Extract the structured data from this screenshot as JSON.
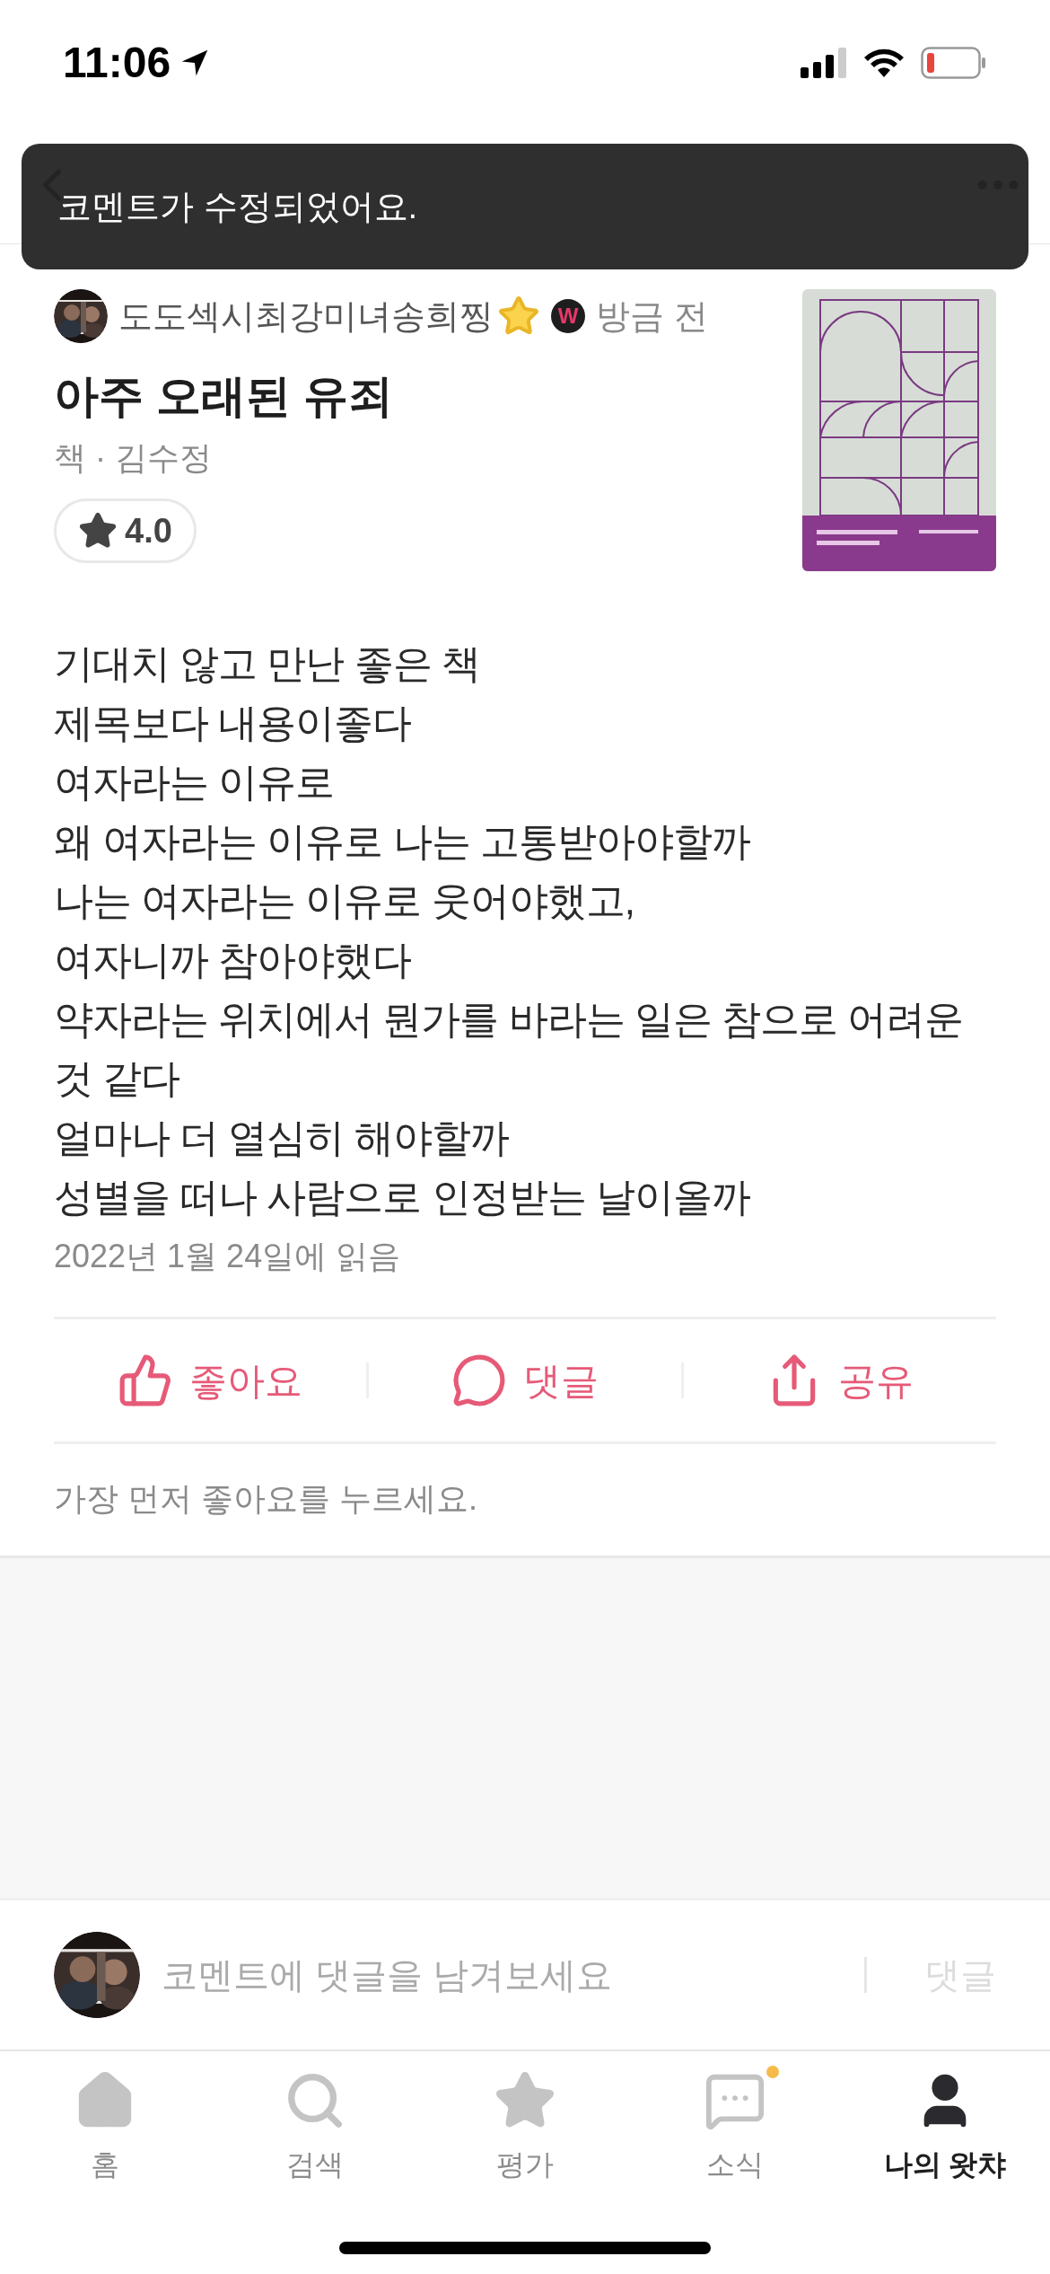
{
  "status_bar": {
    "time": "11:06"
  },
  "toast": {
    "message": "코멘트가 수정되었어요."
  },
  "comment": {
    "user": "도도섹시최강미녀송희찡",
    "badge": "W",
    "time": "방금 전",
    "title": "아주 오래된 유죄",
    "meta": "책 · 김수정",
    "rating": "4.0",
    "lines": [
      "기대치 않고 만난 좋은 책",
      "제목보다 내용이좋다",
      "여자라는 이유로",
      "왜 여자라는 이유로 나는 고통받아야할까",
      "나는 여자라는 이유로 웃어야했고,",
      "여자니까 참아야했다",
      "약자라는 위치에서 뭔가를 바라는 일은 참으로 어려운것 같다",
      "얼마나 더 열심히 해야할까",
      "성별을 떠나 사람으로 인정받는 날이올까"
    ],
    "read_date": "2022년 1월 24일에 읽음"
  },
  "actions": [
    {
      "kind": "like",
      "label": "좋아요"
    },
    {
      "kind": "reply",
      "label": "댓글"
    },
    {
      "kind": "share",
      "label": "공유"
    }
  ],
  "likes_note": "가장 먼저 좋아요를 누르세요.",
  "reply_bar": {
    "placeholder": "코멘트에 댓글을 남겨보세요",
    "send": "댓글"
  },
  "tabs": [
    {
      "kind": "home",
      "label": "홈",
      "selected": false,
      "dot": false
    },
    {
      "kind": "search",
      "label": "검색",
      "selected": false,
      "dot": false
    },
    {
      "kind": "rate",
      "label": "평가",
      "selected": false,
      "dot": false
    },
    {
      "kind": "news",
      "label": "소식",
      "selected": false,
      "dot": true
    },
    {
      "kind": "my",
      "label": "나의 왓챠",
      "selected": true,
      "dot": false
    }
  ]
}
